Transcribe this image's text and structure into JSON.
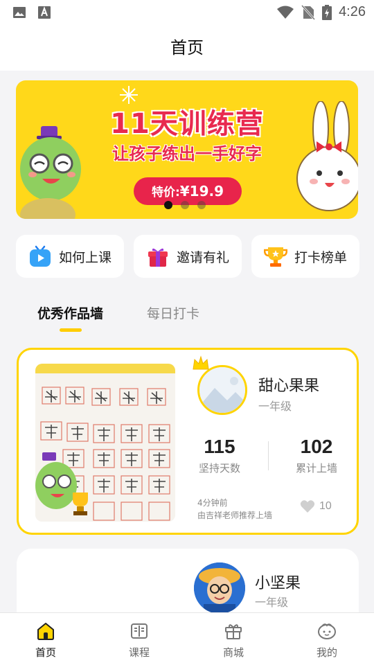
{
  "status_bar": {
    "time": "4:26"
  },
  "header": {
    "title": "首页"
  },
  "banner": {
    "headline": "11天训练营",
    "subtitle": "让孩子练出一手好字",
    "price_label": "特价:",
    "price": "¥19.9",
    "slide_count": 3,
    "active_slide": 1
  },
  "quick_actions": [
    {
      "label": "如何上课",
      "icon": "tv-play-icon"
    },
    {
      "label": "邀请有礼",
      "icon": "gift-icon"
    },
    {
      "label": "打卡榜单",
      "icon": "trophy-icon"
    }
  ],
  "tabs": [
    {
      "label": "优秀作品墙",
      "active": true
    },
    {
      "label": "每日打卡",
      "active": false
    }
  ],
  "works": [
    {
      "name": "甜心果果",
      "grade": "一年级",
      "stats": [
        {
          "value": "115",
          "label": "坚持天数"
        },
        {
          "value": "102",
          "label": "累计上墙"
        }
      ],
      "time": "4分钟前",
      "recommend": "由吉祥老师推荐上墙",
      "likes": "10"
    },
    {
      "name": "小坚果",
      "grade": "一年级"
    }
  ],
  "bottom_nav": [
    {
      "label": "首页",
      "icon": "home-icon",
      "active": true
    },
    {
      "label": "课程",
      "icon": "book-icon",
      "active": false
    },
    {
      "label": "商城",
      "icon": "shop-gift-icon",
      "active": false
    },
    {
      "label": "我的",
      "icon": "profile-icon",
      "active": false
    }
  ],
  "colors": {
    "accent": "#ffd400",
    "banner_bg": "#ffd81a",
    "price_red": "#e8244b"
  }
}
